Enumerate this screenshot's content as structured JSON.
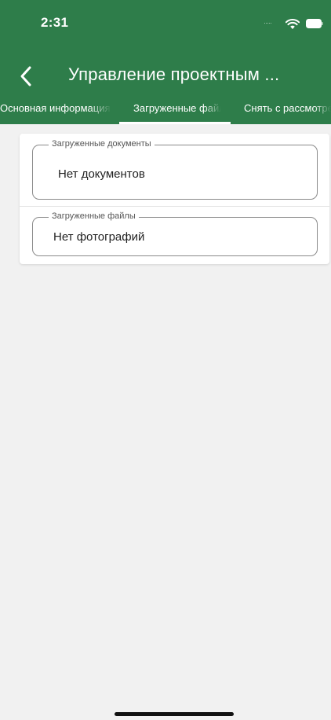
{
  "status_bar": {
    "time": "2:31",
    "signal": "·····",
    "icons": [
      "wifi-icon",
      "battery-icon"
    ]
  },
  "toolbar": {
    "title": "Управление проектным ...",
    "back_icon": "chevron-left-icon"
  },
  "tabs": [
    {
      "label": "Основная информация",
      "selected": false
    },
    {
      "label": "Загруженные файлы",
      "selected": true
    },
    {
      "label": "Снять с рассмотрения",
      "selected": false
    }
  ],
  "documents_field": {
    "label": "Загруженные документы",
    "value": "Нет документов"
  },
  "files_field": {
    "label": "Загруженные файлы",
    "value": "Нет фотографий"
  },
  "colors": {
    "header": "#2e7d4a",
    "background": "#f1f1f1",
    "card": "#ffffff"
  }
}
